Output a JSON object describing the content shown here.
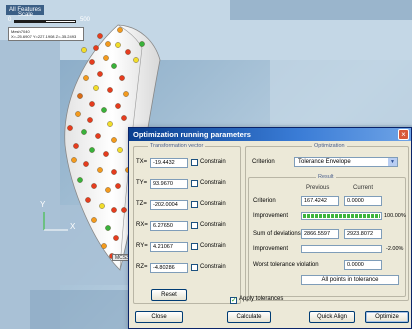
{
  "viewport": {
    "features_label": "All Features",
    "scale_title": "Scale",
    "scale_min": "0",
    "scale_max": "500",
    "coord_lines": [
      "Mesh7040",
      "X=-25.6907 Y=227.1908 Z=-35.2493"
    ],
    "axis_y": "Y",
    "axis_x": "X",
    "corner_tag": "MCS3DB",
    "dot_colors": [
      "#e53c1f",
      "#f39a1e",
      "#f1dd2b",
      "#38b13a",
      "#d86a16"
    ]
  },
  "dialog": {
    "title": "Optimization running parameters",
    "close_icon": "close-icon",
    "transformation": {
      "group_title": "Transformation vector",
      "rows": [
        {
          "label": "TX=",
          "value": "-19.4432",
          "constrain": "Constrain",
          "checked": false
        },
        {
          "label": "TY=",
          "value": "93.9670",
          "constrain": "Constrain",
          "checked": false
        },
        {
          "label": "TZ=",
          "value": "-202.0004",
          "constrain": "Constrain",
          "checked": false
        },
        {
          "label": "RX=",
          "value": "6.27650",
          "constrain": "Constrain",
          "checked": false
        },
        {
          "label": "RY=",
          "value": "4.21067",
          "constrain": "Constrain",
          "checked": false
        },
        {
          "label": "RZ=",
          "value": "-4.80286",
          "constrain": "Constrain",
          "checked": false
        }
      ],
      "reset_label": "Reset"
    },
    "optimization": {
      "group_title": "Optimization",
      "criterion_label": "Criterion",
      "criterion_value": "Tolerance Envelope",
      "result_title": "Result",
      "col_previous": "Previous",
      "col_current": "Current",
      "criterion_row_label": "Criterion",
      "criterion_previous": "167.4242",
      "criterion_current": "0.0000",
      "improvement_label": "Improvement",
      "improvement_pct": "100.00%",
      "improvement_fraction": 1.0,
      "sum_label": "Sum of deviations",
      "sum_previous": "2866.5597",
      "sum_current": "2923.8072",
      "improvement2_label": "Improvement",
      "improvement2_pct": "-2.00%",
      "improvement2_fraction": 0.0,
      "worst_label": "Worst tolerance violation",
      "worst_value": "0.0000",
      "status_text": "All points in tolerance"
    },
    "apply_tolerances_label": "Apply tolerances",
    "apply_tolerances_checked": true,
    "buttons": {
      "close": "Close",
      "calculate": "Calculate",
      "quick_align": "Quick Align",
      "optimize": "Optimize"
    }
  }
}
